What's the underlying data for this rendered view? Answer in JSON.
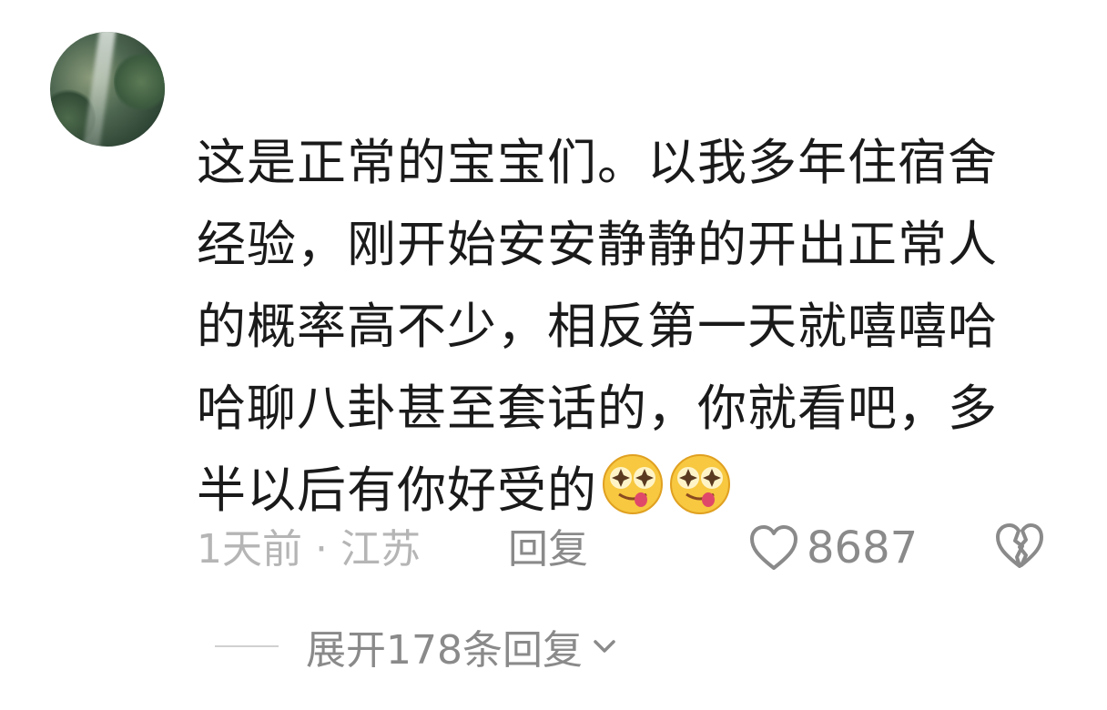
{
  "comment": {
    "text": "这是正常的宝宝们。以我多年住宿舍经验，刚开始安安静静的开出正常人的概率高不少，相反第一天就嘻嘻哈哈聊八卦甚至套话的，你就看吧，多半以后有你好受的",
    "emojis": [
      "star-eyes-tongue-emoji",
      "star-eyes-tongue-emoji"
    ],
    "time": "1天前",
    "separator": "·",
    "location": "江苏",
    "reply_label": "回复",
    "like_count": "8687",
    "expand_label": "展开178条回复"
  },
  "icons": {
    "like": "heart-outline-icon",
    "dislike": "broken-heart-icon",
    "expand": "chevron-down-icon"
  },
  "colors": {
    "text": "#1a1a1a",
    "meta": "#b5b5b5",
    "action": "#8a8a8a"
  }
}
